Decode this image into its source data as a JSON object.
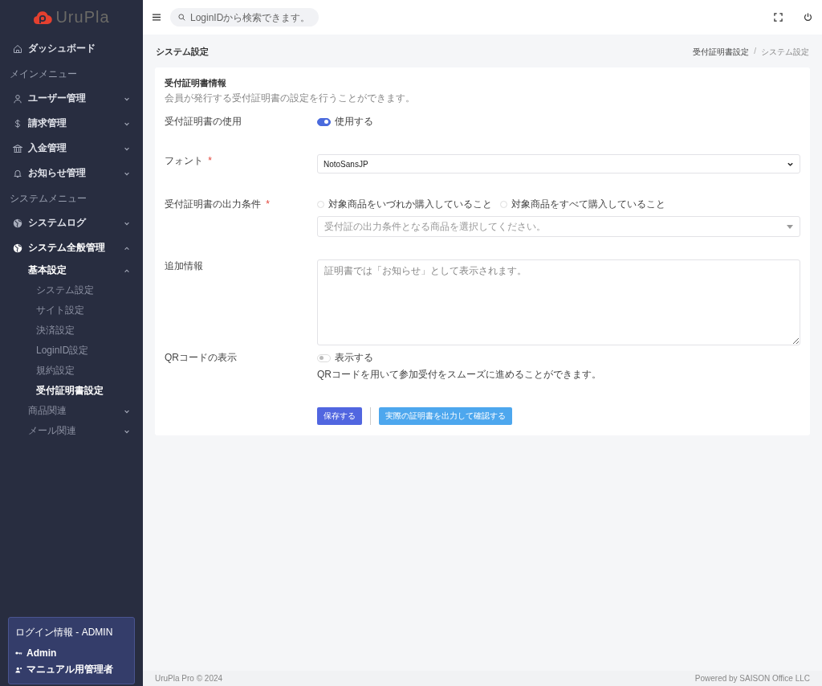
{
  "sidebar": {
    "logo": "UruPla",
    "menu": [
      {
        "kind": "link",
        "label": "ダッシュボード"
      },
      {
        "kind": "heading",
        "label": "メインメニュー"
      },
      {
        "kind": "link",
        "label": "ユーザー管理",
        "expanded": false
      },
      {
        "kind": "link",
        "label": "請求管理",
        "expanded": false
      },
      {
        "kind": "link",
        "label": "入金管理",
        "expanded": false
      },
      {
        "kind": "link",
        "label": "お知らせ管理",
        "expanded": false
      },
      {
        "kind": "heading",
        "label": "システムメニュー"
      },
      {
        "kind": "link",
        "label": "システムログ",
        "expanded": false
      },
      {
        "kind": "link",
        "label": "システム全般管理",
        "expanded": true,
        "children": [
          {
            "label": "基本設定",
            "expanded": true,
            "children": [
              {
                "label": "システム設定",
                "selected": false
              },
              {
                "label": "サイト設定",
                "selected": false
              },
              {
                "label": "決済設定",
                "selected": false
              },
              {
                "label": "LoginID設定",
                "selected": false
              },
              {
                "label": "規約設定",
                "selected": false
              },
              {
                "label": "受付証明書設定",
                "selected": true
              }
            ]
          },
          {
            "label": "商品関連",
            "expanded": false
          },
          {
            "label": "メール関連",
            "expanded": false
          }
        ]
      }
    ],
    "login": {
      "title": "ログイン情報 - ADMIN",
      "user": "Admin",
      "role": "マニュアル用管理者"
    }
  },
  "topbar": {
    "search": {
      "placeholder": "LoginIDから検索できます。"
    }
  },
  "page": {
    "title": "システム設定",
    "breadcrumbs": [
      "受付証明書設定",
      "システム設定"
    ],
    "separator": "/"
  },
  "card": {
    "title": "受付証明書情報",
    "description": "会員が発行する受付証明書の設定を行うことができます。",
    "fields": [
      {
        "kind": "toggle",
        "label": "受付証明書の使用",
        "on": true,
        "option": "使用する"
      },
      {
        "kind": "select",
        "label": "フォント",
        "mark": "*",
        "value": "NotoSansJP"
      },
      {
        "kind": "radios",
        "label": "受付証明書の出力条件",
        "mark": "*",
        "options": [
          {
            "label": "対象商品をいづれか購入していること",
            "selected": false
          },
          {
            "label": "対象商品をすべて購入していること",
            "selected": false
          }
        ],
        "placeholder": "受付証の出力条件となる商品を選択してください。"
      },
      {
        "kind": "textarea",
        "label": "追加情報",
        "placeholder": "証明書では「お知らせ」として表示されます。"
      },
      {
        "kind": "toggle",
        "label": "QRコードの表示",
        "on": false,
        "option": "表示する",
        "help": "QRコードを用いて参加受付をスムーズに進めることができます。"
      }
    ],
    "buttons": [
      {
        "kind": "primary",
        "label": "保存する"
      },
      {
        "kind": "secondary",
        "label": "実際の証明書を出力して確認する"
      }
    ]
  },
  "footer": {
    "left": "UruPla Pro © 2024",
    "right": "Powered by SAISON Office LLC"
  }
}
